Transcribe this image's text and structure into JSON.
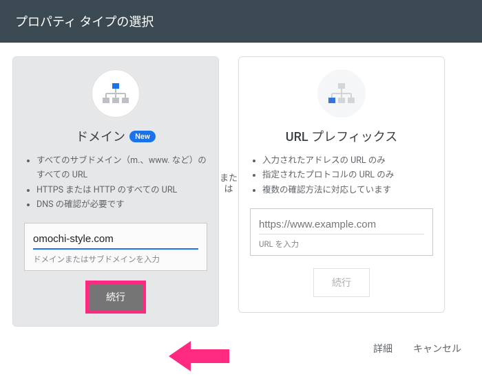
{
  "header": {
    "title": "プロパティ タイプの選択"
  },
  "divider_label": "または",
  "domain_card": {
    "title": "ドメイン",
    "badge": "New",
    "bullets": [
      "すべてのサブドメイン（m.、www. など）のすべての URL",
      "HTTPS または HTTP のすべての URL",
      "DNS の確認が必要です"
    ],
    "input_value": "omochi-style.com",
    "input_hint": "ドメインまたはサブドメインを入力",
    "button": "続行"
  },
  "prefix_card": {
    "title": "URL プレフィックス",
    "bullets": [
      "入力されたアドレスの URL のみ",
      "指定されたプロトコルの URL のみ",
      "複数の確認方法に対応しています"
    ],
    "input_placeholder": "https://www.example.com",
    "input_hint": "URL を入力",
    "button": "続行"
  },
  "footer": {
    "details": "詳細",
    "cancel": "キャンセル"
  }
}
